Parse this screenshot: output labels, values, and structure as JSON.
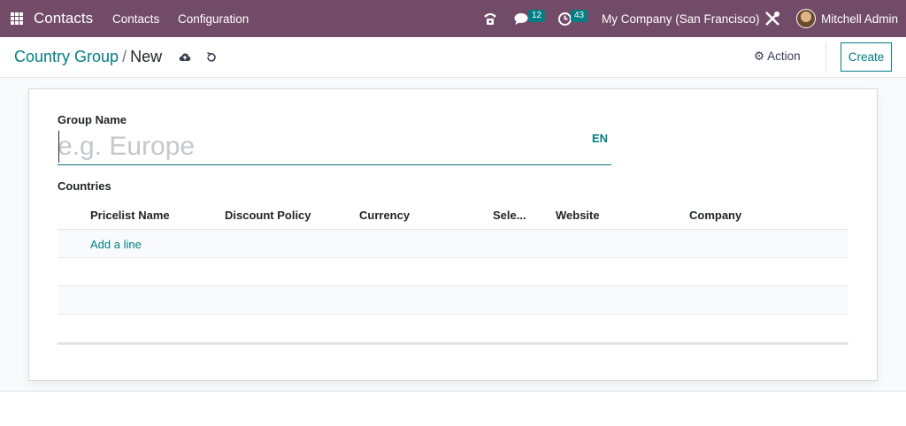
{
  "topbar": {
    "app_name": "Contacts",
    "menu": [
      "Contacts",
      "Configuration"
    ],
    "messages_count": "12",
    "activities_count": "43",
    "company": "My Company (San Francisco)",
    "user": "Mitchell Admin"
  },
  "breadcrumb": {
    "parent": "Country Group",
    "separator": "/",
    "current": "New"
  },
  "controls": {
    "action_label": "Action",
    "create_label": "Create"
  },
  "form": {
    "group_name_label": "Group Name",
    "group_name_value": "",
    "group_name_placeholder": "e.g. Europe",
    "lang_label": "EN",
    "countries_label": "Countries"
  },
  "table": {
    "columns": [
      "Pricelist Name",
      "Discount Policy",
      "Currency",
      "Sele...",
      "Website",
      "Company"
    ],
    "add_line_label": "Add a line"
  },
  "colors": {
    "topbar": "#714b67",
    "accent": "#017e84"
  }
}
